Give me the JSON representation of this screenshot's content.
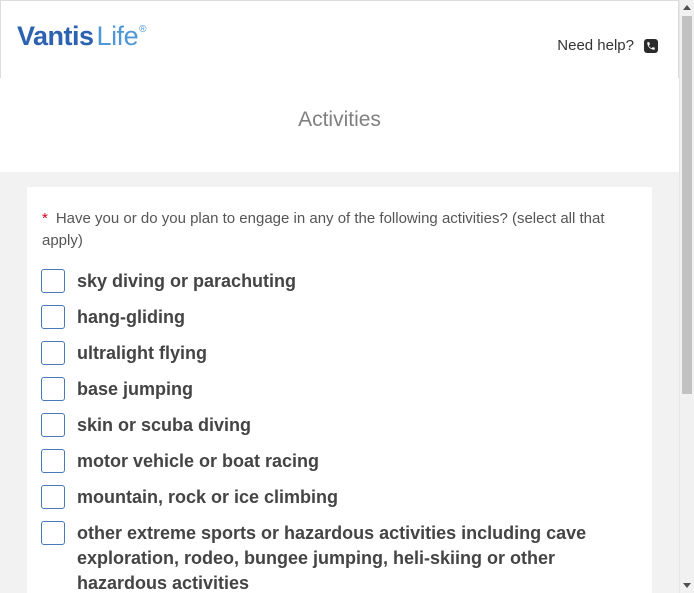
{
  "header": {
    "logo_brand": "Vantis",
    "logo_product": "Life",
    "logo_reg": "®",
    "help_label": "Need help?",
    "help_icon": "phone-icon"
  },
  "page": {
    "title": "Activities"
  },
  "question": {
    "required_marker": "*",
    "text": "Have you or do you plan to engage in any of the following activities? (select all that apply)"
  },
  "options": [
    {
      "label": "sky diving or parachuting",
      "checked": false
    },
    {
      "label": "hang-gliding",
      "checked": false
    },
    {
      "label": "ultralight flying",
      "checked": false
    },
    {
      "label": "base jumping",
      "checked": false
    },
    {
      "label": "skin or scuba diving",
      "checked": false
    },
    {
      "label": "motor vehicle or boat racing",
      "checked": false
    },
    {
      "label": "mountain, rock or ice climbing",
      "checked": false
    },
    {
      "label": "other extreme sports or hazardous activities including cave exploration, rodeo, bungee jumping, heli-skiing or other hazardous activities",
      "checked": false
    }
  ],
  "colors": {
    "brand_dark": "#2c62b0",
    "brand_light": "#4f97d6",
    "required": "#d0021b",
    "checkbox_border": "#4a78b8"
  }
}
